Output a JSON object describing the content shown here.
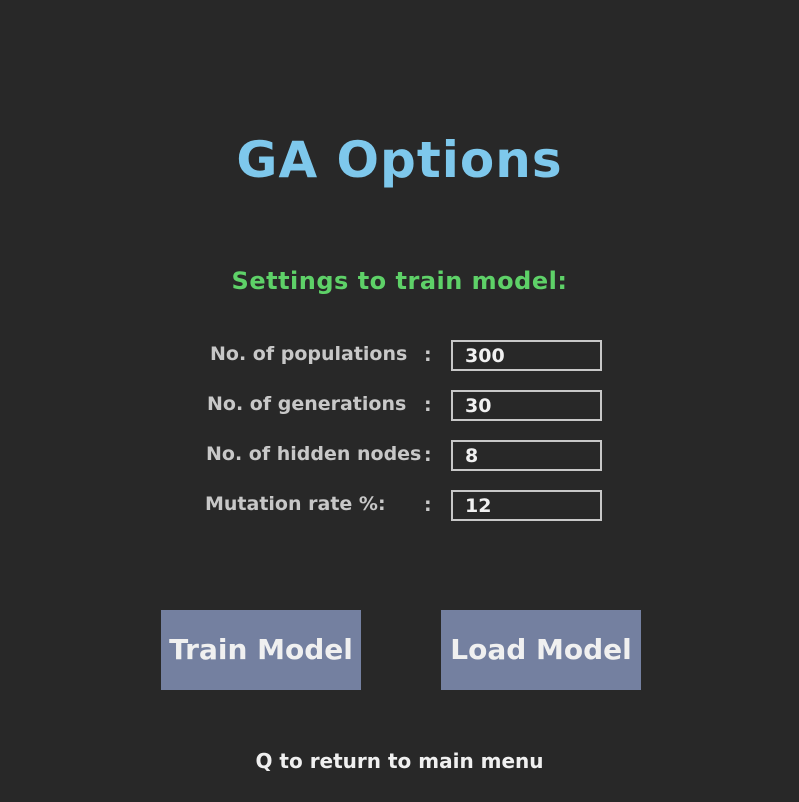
{
  "screen": {
    "title": "GA Options",
    "subtitle": "Settings to train model:",
    "footer": "Q to return to main menu"
  },
  "settings": [
    {
      "label": "No. of populations",
      "colon": ":",
      "value": "300"
    },
    {
      "label": "No. of generations",
      "colon": ":",
      "value": "30"
    },
    {
      "label": "No. of hidden nodes",
      "colon": ":",
      "value": "8"
    },
    {
      "label": "Mutation rate %:",
      "colon": ":",
      "value": "12"
    }
  ],
  "buttons": {
    "train_label": "Train Model",
    "load_label": "Load Model"
  },
  "colors": {
    "background": "#282828",
    "title": "#7ec8ec",
    "subtitle": "#5ed168",
    "label": "#c8c8c8",
    "input_text": "#f0f0f0",
    "button_bg": "#7480a0",
    "button_text": "#f0f0f0",
    "footer": "#f0f0f0"
  }
}
